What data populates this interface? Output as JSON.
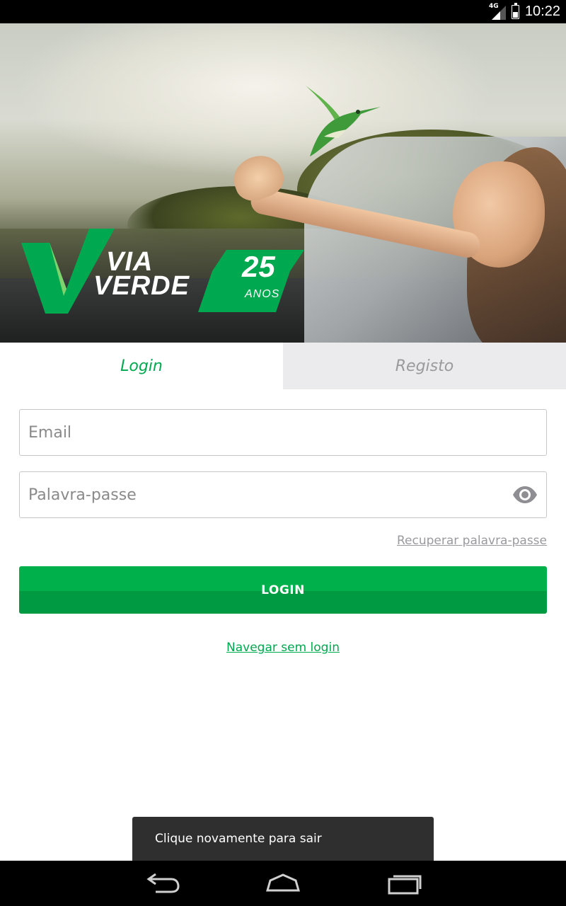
{
  "status_bar": {
    "network": "4G",
    "time": "10:22"
  },
  "hero": {
    "brand_line1": "VIA",
    "brand_line2": "VERDE",
    "anniversary_number": "25",
    "anniversary_word": "ANOS"
  },
  "tabs": [
    {
      "label": "Login",
      "active": true
    },
    {
      "label": "Registo",
      "active": false
    }
  ],
  "form": {
    "email_placeholder": "Email",
    "email_value": "",
    "password_placeholder": "Palavra-passe",
    "password_value": "",
    "toggle_visibility_icon": "eye-icon",
    "recover_link": "Recuperar palavra-passe",
    "login_button": "LOGIN",
    "browse_link": "Navegar sem login"
  },
  "toast": {
    "message": "Clique novamente para sair"
  },
  "navigation_bar": {
    "back_icon": "back-icon",
    "home_icon": "home-icon",
    "recent_apps_icon": "recent-apps-icon"
  },
  "colors": {
    "accent_green": "#00a94f",
    "button_green": "#00b04a",
    "inactive_tab_bg": "#ebeaed",
    "inactive_text": "#9a9a9e",
    "toast_bg": "#2f2f2f"
  }
}
